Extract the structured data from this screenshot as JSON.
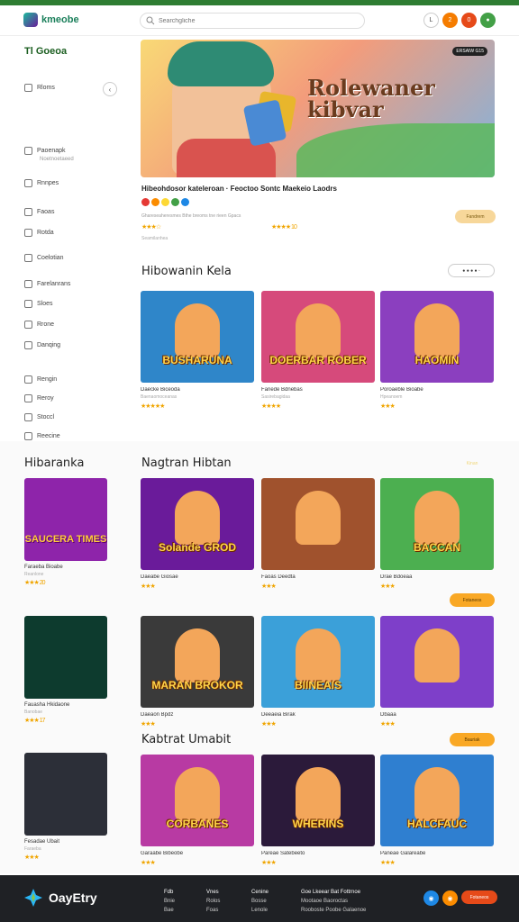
{
  "status_strip": "",
  "header": {
    "logo_text": "kmeobe",
    "search_placeholder": "Searchgliche",
    "icons": [
      {
        "name": "user-icon",
        "label": "L",
        "color": "#ffffff"
      },
      {
        "name": "notification-icon",
        "label": "2",
        "color": "#f57c00"
      },
      {
        "name": "cart-icon",
        "label": "0",
        "color": "#e64a19"
      },
      {
        "name": "profile-icon",
        "label": "",
        "color": "#43a047"
      }
    ]
  },
  "sidebar": {
    "title": "Tl Goeoa",
    "items": [
      {
        "label": "Rloms",
        "icon": "home-icon"
      },
      {
        "label": "Paoenapk",
        "icon": "grid-icon",
        "sub": "Noetnoetaeed"
      },
      {
        "label": "Rnnpes",
        "icon": "list-icon"
      },
      {
        "label": "Faoas",
        "icon": "star-icon"
      },
      {
        "label": "Rotda",
        "icon": "tag-icon"
      },
      {
        "label": "Coelotian",
        "icon": "folder-icon"
      },
      {
        "label": "Farelanrans",
        "icon": "trophy-icon"
      },
      {
        "label": "Sloes",
        "icon": "store-icon"
      },
      {
        "label": "Rrone",
        "icon": "calendar-icon"
      },
      {
        "label": "Danqing",
        "icon": "chart-icon"
      },
      {
        "label": "Rengin",
        "icon": "user-icon"
      },
      {
        "label": "Reroy",
        "icon": "history-icon"
      },
      {
        "label": "Stoccl",
        "icon": "settings-icon"
      },
      {
        "label": "Reecine",
        "icon": "help-icon"
      }
    ]
  },
  "hero": {
    "title_line1": "Rolewaner",
    "title_line2": "kibvar",
    "badge": "ERSAIW G15",
    "info_title": "Hibeohdosor kateleroan  ·  Feoctoo Sontc Maekeio Laodrs",
    "sub": "Ghareseaheresmes Bthe breoms tne rieen Gpacs",
    "sub2": "Seamilanhea",
    "button": "Fandrem",
    "rating1": "★★★☆",
    "rating2": "★★★★ 10"
  },
  "sections": {
    "featured": {
      "title": "Hibowanin Kela",
      "pill": "● ● ● ●  ◦"
    },
    "left_col": {
      "title": "Hibaranka"
    },
    "new": {
      "title": "Nagtran Hibtan",
      "pill": "Kinan"
    },
    "latest": {
      "title": "Kabtrat Umabit",
      "pill": "Bauriak"
    }
  },
  "featured_cards": [
    {
      "title": "BUSHARUNA",
      "name": "Daecke Biceoda",
      "meta": "Baenaomoceanas",
      "stars": "★★★★★",
      "bg": "#2f86c9"
    },
    {
      "title": "DOERBAR ROBER",
      "name": "Fanede Bdnebas",
      "meta": "Sasirebagidaa",
      "stars": "★★★★",
      "bg": "#d64a7b"
    },
    {
      "title": "HAOMIN",
      "name": "Poroaeble Bioabe",
      "meta": "Hpeanoem",
      "stars": "★★★",
      "bg": "#8b3fbf"
    }
  ],
  "left_cards": [
    {
      "title": "SAUCERA TIMES",
      "name": "Faraeba Bioabe",
      "meta": "Reanlone",
      "stars": "★★★ 20",
      "bg": "#8e24aa"
    },
    {
      "title": "",
      "name": "Fauasha Hkidaone",
      "meta": "Banobae",
      "stars": "★★★ 17",
      "bg": "#0d3b2e"
    },
    {
      "title": "",
      "name": "Fesadae Ubait",
      "meta": "Faraeba",
      "stars": "★★★",
      "bg": "#2c2f38"
    }
  ],
  "grid_rows": [
    [
      {
        "title": "Solande GROD",
        "name": "Daeabe Giosae",
        "meta": "",
        "stars": "★★★",
        "bg": "#6a1b9a"
      },
      {
        "title": "",
        "name": "Faoas Deedta",
        "meta": "",
        "stars": "★★★",
        "bg": "#a0522d"
      },
      {
        "title": "BACCAN",
        "name": "Drae Bdoeaa",
        "meta": "",
        "stars": "★★★",
        "bg": "#4caf50"
      }
    ],
    [
      {
        "title": "MARAN BROKOR",
        "name": "Daeaon Bpdz",
        "meta": "",
        "stars": "★★★",
        "bg": "#3a3a3a"
      },
      {
        "title": "BIINEAIS",
        "name": "Deeaeia Birak",
        "meta": "",
        "stars": "★★★",
        "bg": "#3ba0d9"
      },
      {
        "title": "",
        "name": "Dbaaa",
        "meta": "",
        "stars": "★★★",
        "bg": "#7e3fc9"
      }
    ],
    [
      {
        "title": "CORBANES",
        "name": "Garaabe Bibeobe",
        "meta": "",
        "stars": "★★★",
        "bg": "#b83aa3"
      },
      {
        "title": "WHERINS",
        "name": "Pareae Satebeeto",
        "meta": "",
        "stars": "★★★",
        "bg": "#2b1a3a"
      },
      {
        "title": "HALCFAUC",
        "name": "Paneae Galareabe",
        "meta": "",
        "stars": "★★★",
        "bg": "#2f7fd0"
      }
    ]
  ],
  "footer": {
    "logo_text": "OayEtry",
    "cols": [
      {
        "head": "Fdb",
        "lines": [
          "Bnie",
          "Bae"
        ]
      },
      {
        "head": "Vnes",
        "lines": [
          "Rolos",
          "Foas"
        ]
      },
      {
        "head": "Cenine",
        "lines": [
          "Bosse",
          "Lenole"
        ]
      },
      {
        "head": "Goe Lkeear Bat Fottrnoe",
        "lines": [
          "Mootaoe Baoroctas",
          "Rooboste Poobe Galaenoe"
        ]
      }
    ],
    "button": "Fotaneos"
  }
}
